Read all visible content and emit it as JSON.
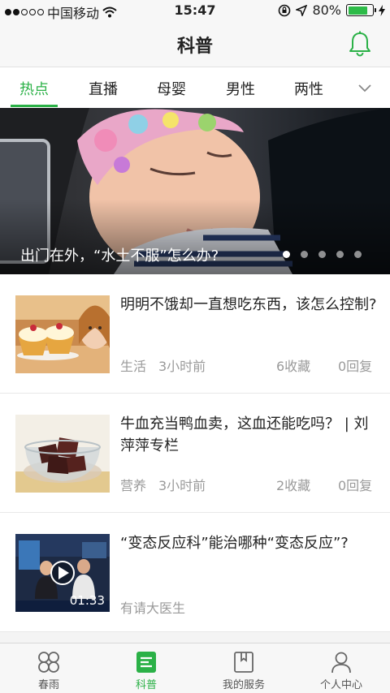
{
  "status_bar": {
    "carrier": "中国移动",
    "time": "15:47",
    "battery": "80%",
    "battery_level": 0.8
  },
  "header": {
    "title": "科普",
    "bell_icon": "bell-icon"
  },
  "tabs": [
    {
      "label": "热点",
      "active": true
    },
    {
      "label": "直播"
    },
    {
      "label": "母婴"
    },
    {
      "label": "男性"
    },
    {
      "label": "两性"
    }
  ],
  "banner": {
    "caption": "出门在外，“水土不服”怎么办?",
    "page_count": 5,
    "current_page": 1
  },
  "feed": [
    {
      "headline": "明明不饿却一直想吃东西，该怎么控制?",
      "category": "生活",
      "time": "3小时前",
      "favorites": "6收藏",
      "replies": "0回复"
    },
    {
      "headline": "牛血充当鸭血卖，这血还能吃吗？ | 刘萍萍专栏",
      "category": "营养",
      "time": "3小时前",
      "favorites": "2收藏",
      "replies": "0回复"
    },
    {
      "headline": "“变态反应科”能治哪种“变态反应”?",
      "source": "有请大医生",
      "duration": "01:33"
    }
  ],
  "bottom_nav": [
    {
      "label": "春雨",
      "icon": "clover-icon"
    },
    {
      "label": "科普",
      "icon": "article-icon",
      "active": true
    },
    {
      "label": "我的服务",
      "icon": "book-icon"
    },
    {
      "label": "个人中心",
      "icon": "person-icon"
    }
  ],
  "colors": {
    "accent": "#2bb147",
    "text": "#222222",
    "meta": "#9a9a9a"
  }
}
